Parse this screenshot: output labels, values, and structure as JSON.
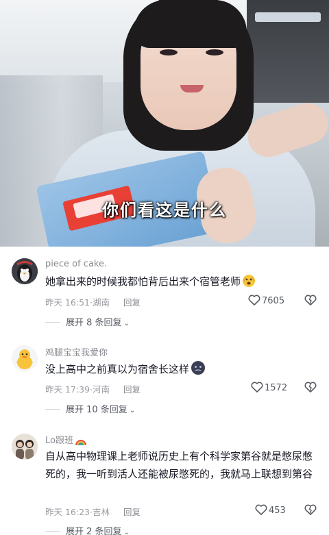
{
  "video": {
    "subtitle": "你们看这是什么"
  },
  "comments": [
    {
      "username": "piece of cake.",
      "text": "她拿出来的时候我都怕背后出来个宿管老师",
      "time": "昨天 16:51",
      "location": "湖南",
      "reply_label": "回复",
      "likes": "7605",
      "expand_label": "展开 8 条回复"
    },
    {
      "username": "鸡腿宝宝我爱你",
      "text": "没上高中之前真以为宿舍长这样",
      "time": "昨天 17:39",
      "location": "河南",
      "reply_label": "回复",
      "likes": "1572",
      "expand_label": "展开 10 条回复"
    },
    {
      "username": "Lo跟班",
      "text": "自从高中物理课上老师说历史上有个科学家第谷就是憋尿憋死的，我一听到活人还能被尿憋死的，我就马上联想到第谷",
      "time": "昨天 16:23",
      "location": "吉林",
      "reply_label": "回复",
      "likes": "453",
      "expand_label": "展开 2 条回复"
    }
  ],
  "icons": {
    "like": "heart-outline-icon",
    "dislike": "broken-heart-icon",
    "expand": "chevron-down-icon"
  },
  "colors": {
    "text_primary": "#161823",
    "text_secondary": "#8a8b91"
  }
}
